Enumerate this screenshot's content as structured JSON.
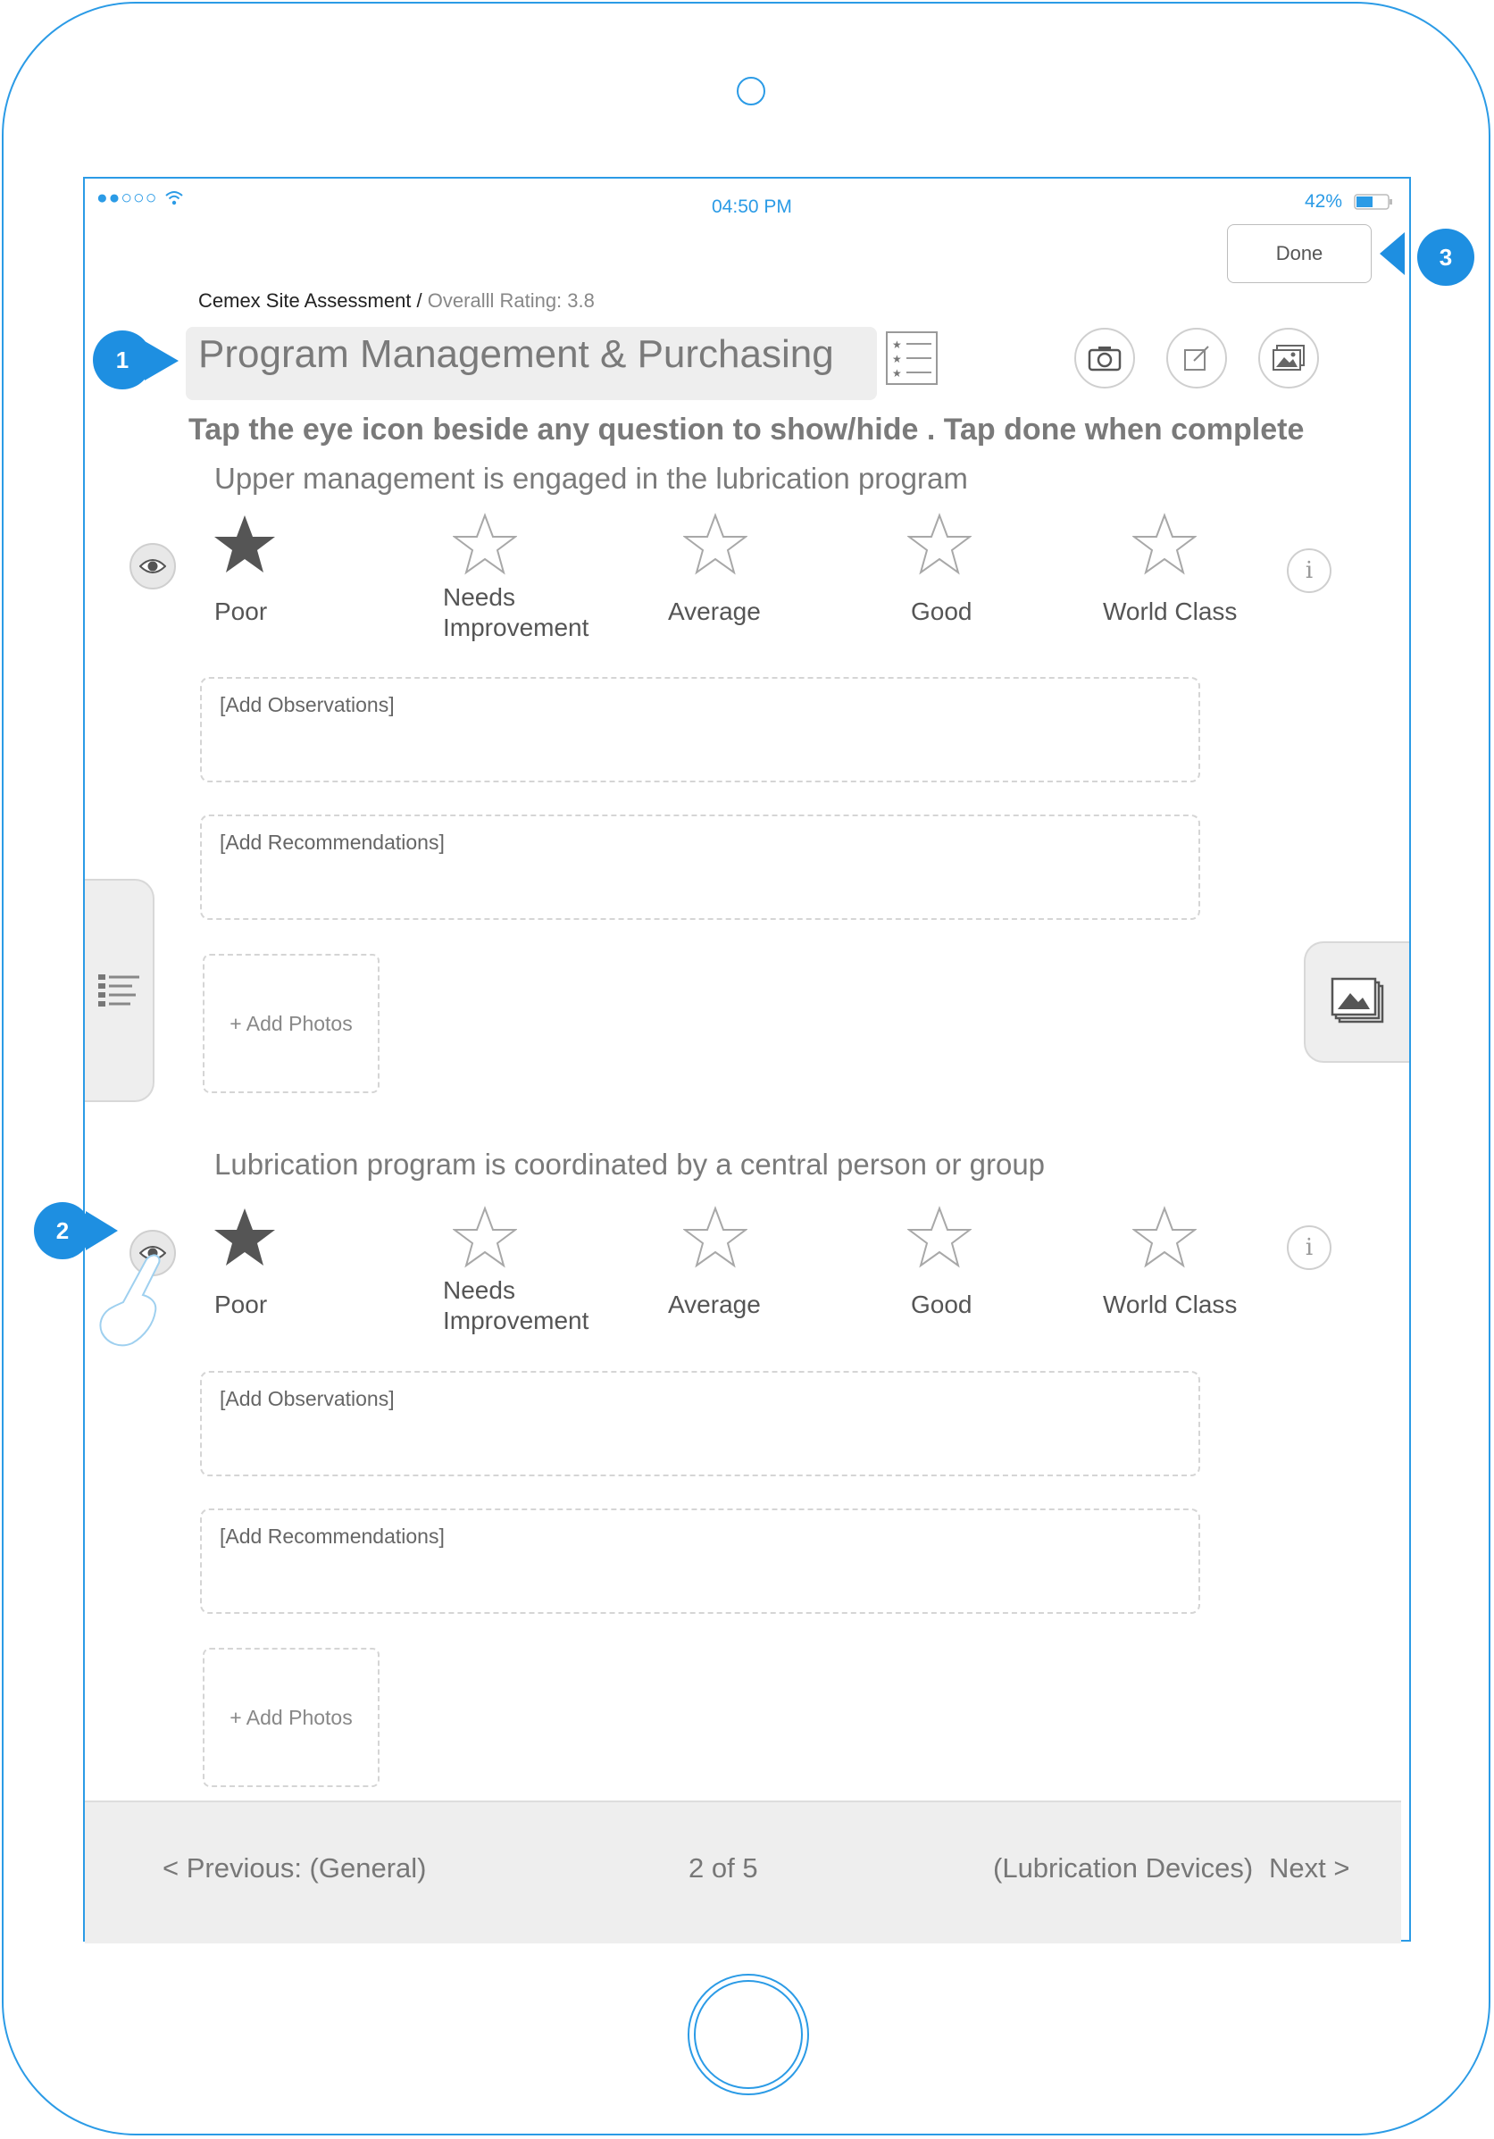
{
  "status_bar": {
    "signal": "●●○○○",
    "time": "04:50 PM",
    "battery": "42%"
  },
  "header": {
    "done_label": "Done",
    "breadcrumb_title": "Cemex Site Assessment",
    "breadcrumb_separator": " / ",
    "overall_rating": "Overalll Rating: 3.8",
    "section_title": "Program Management & Purchasing",
    "instruction": "Tap the eye icon beside any question to show/hide . Tap done when complete"
  },
  "callouts": [
    "1",
    "2",
    "3"
  ],
  "rating_labels": {
    "poor": "Poor",
    "needs_line1": "Needs",
    "needs_line2": "Improvement",
    "average": "Average",
    "good": "Good",
    "world_class": "World Class"
  },
  "questions": [
    {
      "text": "Upper management is engaged in the lubrication program",
      "rating_stars": 1,
      "observations_placeholder": "[Add Observations]",
      "recommendations_placeholder": "[Add Recommendations]",
      "add_photos_label": "+ Add Photos"
    },
    {
      "text": "Lubrication program is coordinated by a central person or group",
      "rating_stars": 1,
      "observations_placeholder": "[Add Observations]",
      "recommendations_placeholder": "[Add Recommendations]",
      "add_photos_label": "+ Add Photos"
    }
  ],
  "footer": {
    "previous": "< Previous: (General)",
    "page_indicator": "2 of 5",
    "next_section": "(Lubrication Devices)",
    "next": "Next >"
  },
  "colors": {
    "accent": "#2b9be6",
    "callout": "#1e8fe1",
    "star_filled": "#555555",
    "star_empty": "#a8a8a8"
  },
  "icons": {
    "info": "i"
  }
}
